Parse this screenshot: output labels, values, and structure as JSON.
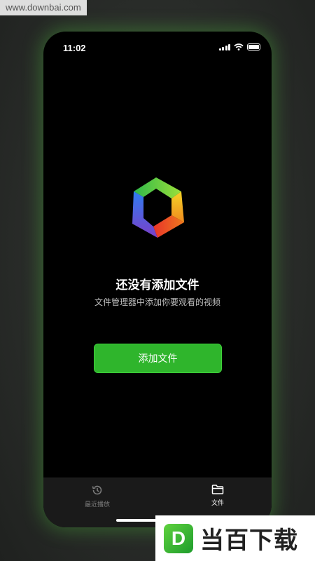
{
  "watermark": "www.downbai.com",
  "status_bar": {
    "time": "11:02"
  },
  "empty_state": {
    "title": "还没有添加文件",
    "subtitle": "文件管理器中添加你要观看的视频"
  },
  "add_button_label": "添加文件",
  "tabs": [
    {
      "label": "最近播放",
      "icon": "history-icon",
      "active": false
    },
    {
      "label": "文件",
      "icon": "folder-icon",
      "active": true
    }
  ],
  "brand": {
    "letter": "D",
    "text": "当百下载"
  },
  "colors": {
    "accent": "#2fb52c",
    "background": "#000000",
    "tab_bar": "#1a1a1a"
  }
}
